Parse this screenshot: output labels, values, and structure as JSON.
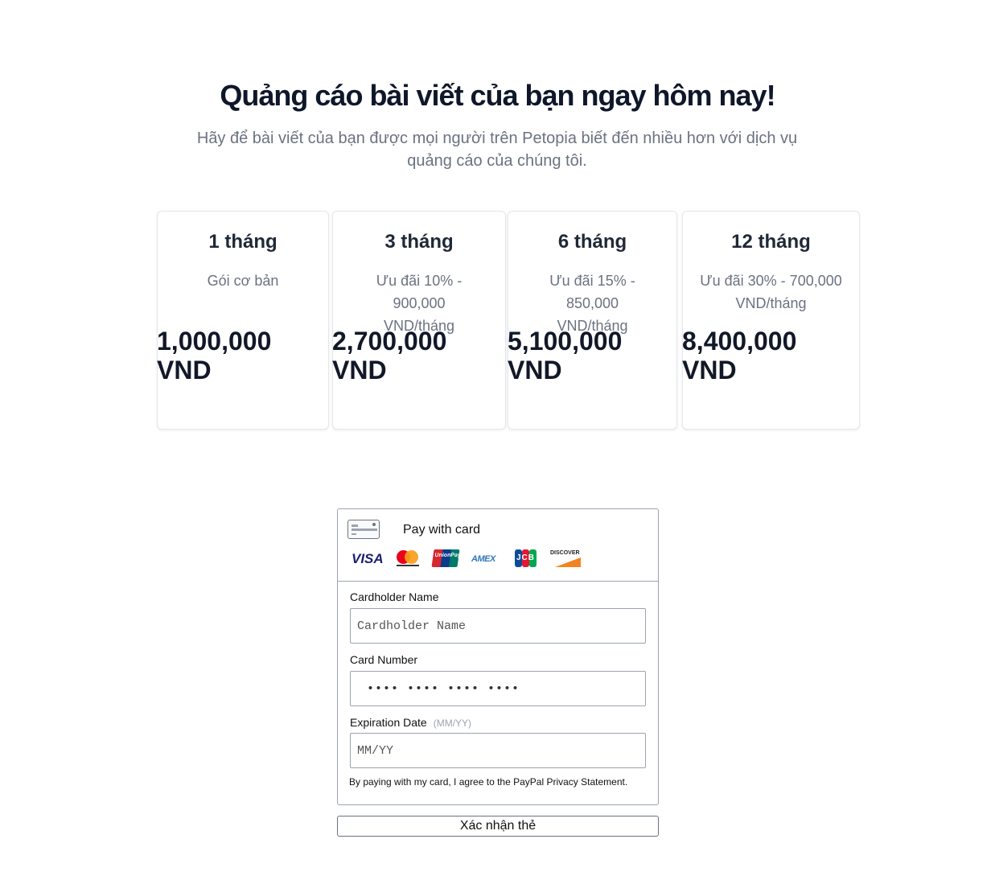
{
  "hero": {
    "title": "Quảng cáo bài viết của bạn ngay hôm nay!",
    "subtitle": "Hãy để bài viết của bạn được mọi người trên Petopia biết đến nhiều hơn với dịch vụ quảng cáo của chúng tôi."
  },
  "plans": [
    {
      "name": "1 tháng",
      "desc": "Gói cơ bản",
      "price": "1,000,000 VND"
    },
    {
      "name": "3 tháng",
      "desc": "Ưu đãi 10% - 900,000 VND/tháng",
      "price": "2,700,000 VND"
    },
    {
      "name": "6 tháng",
      "desc": "Ưu đãi 15% - 850,000 VND/tháng",
      "price": "5,100,000 VND"
    },
    {
      "name": "12 tháng",
      "desc": "Ưu đãi 30% - 700,000 VND/tháng",
      "price": "8,400,000 VND"
    }
  ],
  "payment": {
    "title": "Pay with card",
    "brands": [
      "VISA",
      "mastercard",
      "UnionPay",
      "AMEX",
      "JCB",
      "DISCOVER"
    ],
    "cardholder_label": "Cardholder Name",
    "cardholder_placeholder": "Cardholder Name",
    "card_number_label": "Card Number",
    "card_number_placeholder": "•••• •••• •••• ••••",
    "expiry_label": "Expiration Date",
    "expiry_hint": "(MM/YY)",
    "expiry_placeholder": "MM/YY",
    "agreement": "By paying with my card, I agree to the PayPal Privacy Statement."
  },
  "confirm_label": "Xác nhận thẻ"
}
